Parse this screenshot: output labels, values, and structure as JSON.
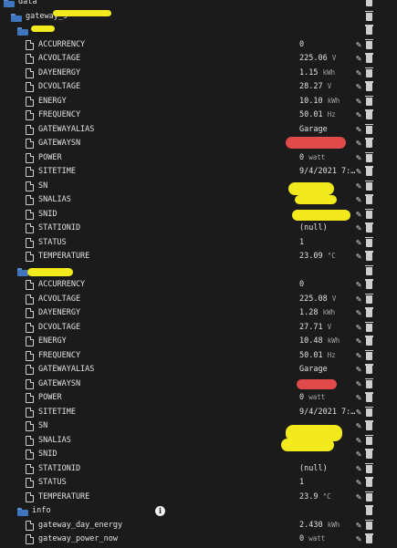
{
  "tree": {
    "root_label": "data",
    "gateway_label": "gateway_9",
    "group1_label": "",
    "group2_label": "",
    "info_label": "info"
  },
  "group1": [
    {
      "label": "ACCURRENCY",
      "value": "0",
      "unit": ""
    },
    {
      "label": "ACVOLTAGE",
      "value": "225.06",
      "unit": "V"
    },
    {
      "label": "DAYENERGY",
      "value": "1.15",
      "unit": "kWh"
    },
    {
      "label": "DCVOLTAGE",
      "value": "28.27",
      "unit": "V"
    },
    {
      "label": "ENERGY",
      "value": "10.10",
      "unit": "kWh"
    },
    {
      "label": "FREQUENCY",
      "value": "50.01",
      "unit": "Hz"
    },
    {
      "label": "GATEWAYALIAS",
      "value": "Garage",
      "unit": ""
    },
    {
      "label": "GATEWAYSN",
      "value": "",
      "unit": ""
    },
    {
      "label": "POWER",
      "value": "0",
      "unit": "watt"
    },
    {
      "label": "SITETIME",
      "value": "9/4/2021 7:…",
      "unit": ""
    },
    {
      "label": "SN",
      "value": "",
      "unit": ""
    },
    {
      "label": "SNALIAS",
      "value": "",
      "unit": ""
    },
    {
      "label": "SNID",
      "value": "",
      "unit": ""
    },
    {
      "label": "STATIONID",
      "value": "(null)",
      "unit": ""
    },
    {
      "label": "STATUS",
      "value": "1",
      "unit": ""
    },
    {
      "label": "TEMPERATURE",
      "value": "23.09",
      "unit": "°C"
    }
  ],
  "group2": [
    {
      "label": "ACCURRENCY",
      "value": "0",
      "unit": ""
    },
    {
      "label": "ACVOLTAGE",
      "value": "225.08",
      "unit": "V"
    },
    {
      "label": "DAYENERGY",
      "value": "1.28",
      "unit": "kWh"
    },
    {
      "label": "DCVOLTAGE",
      "value": "27.71",
      "unit": "V"
    },
    {
      "label": "ENERGY",
      "value": "10.48",
      "unit": "kWh"
    },
    {
      "label": "FREQUENCY",
      "value": "50.01",
      "unit": "Hz"
    },
    {
      "label": "GATEWAYALIAS",
      "value": "Garage",
      "unit": ""
    },
    {
      "label": "GATEWAYSN",
      "value": "",
      "unit": ""
    },
    {
      "label": "POWER",
      "value": "0",
      "unit": "watt"
    },
    {
      "label": "SITETIME",
      "value": "9/4/2021 7:…",
      "unit": ""
    },
    {
      "label": "SN",
      "value": "",
      "unit": ""
    },
    {
      "label": "SNALIAS",
      "value": "",
      "unit": ""
    },
    {
      "label": "SNID",
      "value": "",
      "unit": ""
    },
    {
      "label": "STATIONID",
      "value": "(null)",
      "unit": ""
    },
    {
      "label": "STATUS",
      "value": "1",
      "unit": ""
    },
    {
      "label": "TEMPERATURE",
      "value": "23.9",
      "unit": "°C"
    }
  ],
  "info": [
    {
      "label": "gateway_day_energy",
      "value": "2.430",
      "unit": "kWh"
    },
    {
      "label": "gateway_power_now",
      "value": "0",
      "unit": "watt"
    }
  ],
  "colors": {
    "folder": "#3f74be",
    "highlight_yellow": "#f2ea1d",
    "highlight_red": "#e04a4a"
  }
}
